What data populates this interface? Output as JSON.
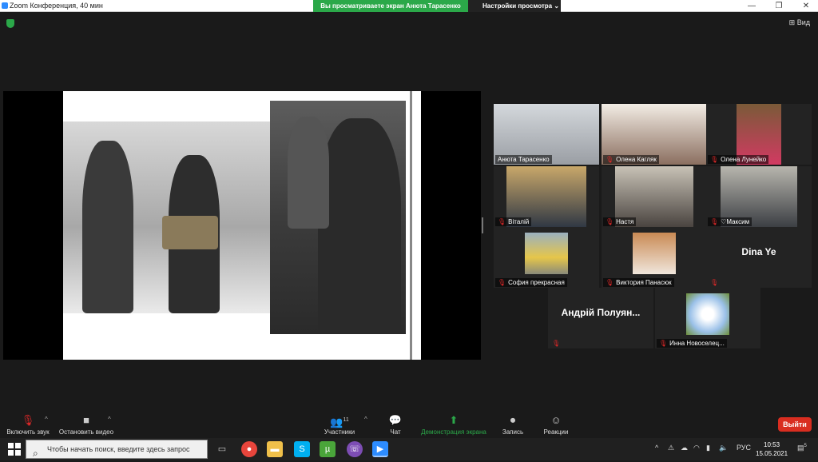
{
  "window": {
    "title": "Zoom Конференция, 40 мин",
    "minimize": "—",
    "maximize": "❐",
    "close": "✕"
  },
  "share_banner": "Вы просматриваете экран Анюта Тарасенко",
  "view_options": "Настройки просмотра",
  "view_options_caret": "⌄",
  "view_button": "Вид",
  "view_icon": "grid-icon",
  "participants": [
    {
      "name": "Анюта Тарасенко",
      "muted": false,
      "active": true
    },
    {
      "name": "Олена Кагляк",
      "muted": true
    },
    {
      "name": "Олена Лунейко",
      "muted": true
    },
    {
      "name": "Віталій",
      "muted": true
    },
    {
      "name": "Настя",
      "muted": true
    },
    {
      "name": "Максим",
      "muted": false,
      "heart": "♡"
    },
    {
      "name": "София прекрасная",
      "muted": true
    },
    {
      "name": "Виктория Панасюк",
      "muted": true
    },
    {
      "name": "Dina Ye",
      "muted": true,
      "video": false
    },
    {
      "name": "Андрій Полуян...",
      "muted": true,
      "video": false
    },
    {
      "name": "Инна Новоселец...",
      "muted": true
    }
  ],
  "mute_glyph": "🎙",
  "toolbar": {
    "mic": "Включить звук",
    "video": "Остановить видео",
    "participants": "Участники",
    "participants_count": "11",
    "chat": "Чат",
    "share": "Демонстрация экрана",
    "record": "Запись",
    "reactions": "Реакции",
    "leave": "Выйти",
    "caret": "^"
  },
  "taskbar": {
    "search_placeholder": "Чтобы начать поиск, введите здесь запрос",
    "language": "РУС",
    "time": "10:53",
    "date": "15.05.2021",
    "notification_count": "5",
    "tray_chevron": "^"
  },
  "colors": {
    "active_speaker": "#b3dd4f",
    "share_green": "#2ba849",
    "leave_red": "#d92d20",
    "mute_red": "#e02828"
  }
}
